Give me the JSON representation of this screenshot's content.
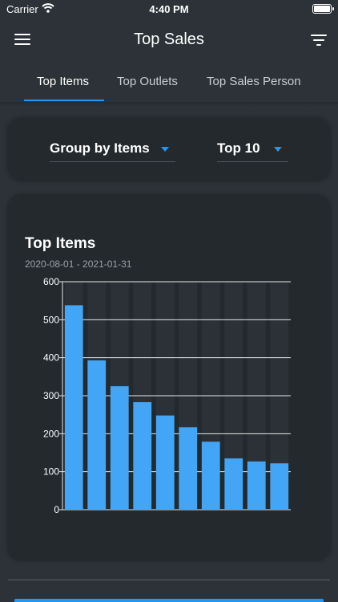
{
  "status_bar": {
    "carrier": "Carrier",
    "time": "4:40 PM"
  },
  "nav": {
    "title": "Top Sales",
    "menu_icon": "hamburger-menu-icon",
    "filter_icon": "filter-list-icon"
  },
  "tabs": [
    {
      "label": "Top Items",
      "active": true
    },
    {
      "label": "Top Outlets",
      "active": false
    },
    {
      "label": "Top Sales Person",
      "active": false
    }
  ],
  "filters": {
    "group_by": "Group by Items",
    "top_n": "Top 10"
  },
  "colors": {
    "accent": "#2196f3",
    "bar": "#42a5f5",
    "background": "#2c3237",
    "card": "#23292d"
  },
  "chart_data": {
    "type": "bar",
    "title": "Top Items",
    "subtitle": "2020-08-01 - 2021-01-31",
    "categories": [],
    "values": [
      538,
      393,
      325,
      283,
      248,
      217,
      179,
      135,
      127,
      122
    ],
    "ylim": [
      0,
      600
    ],
    "yticks": [
      0,
      100,
      200,
      300,
      400,
      500,
      600
    ],
    "grid": true,
    "xlabel": "",
    "ylabel": ""
  }
}
